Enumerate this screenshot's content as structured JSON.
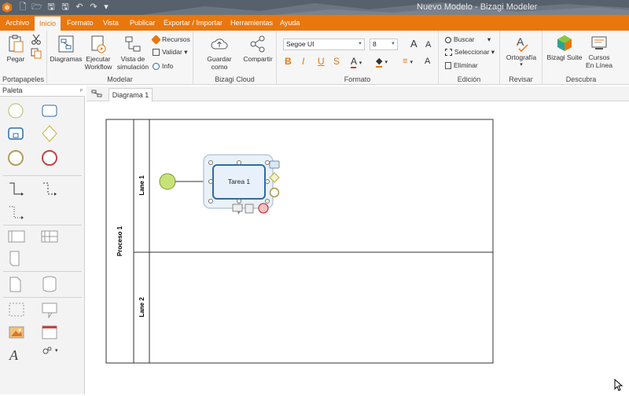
{
  "window": {
    "title": "Nuevo Modelo - Bizagi Modeler"
  },
  "ribbon_tabs": [
    {
      "label": "Archivo"
    },
    {
      "label": "Inicio",
      "active": true
    },
    {
      "label": "Formato"
    },
    {
      "label": "Vista"
    },
    {
      "label": "Publicar"
    },
    {
      "label": "Exportar / Importar"
    },
    {
      "label": "Herramientas"
    },
    {
      "label": "Ayuda"
    }
  ],
  "groups": {
    "portapapeles": {
      "label": "Portapapeles",
      "pegar": "Pegar"
    },
    "modelar": {
      "label": "Modelar",
      "diagramas": "Diagramas",
      "ejecutar": [
        "Ejecutar",
        "Workflow"
      ],
      "vista": [
        "Vista de",
        "simulación"
      ],
      "recursos": "Recursos",
      "validar": "Validar",
      "info": "Info"
    },
    "cloud": {
      "label": "Bizagi Cloud",
      "guardar": "Guardar como",
      "compartir": "Compartir"
    },
    "formato": {
      "label": "Formato",
      "font": "Segoe UI",
      "size": "8"
    },
    "edicion": {
      "label": "Edición",
      "buscar": "Buscar",
      "seleccionar": "Seleccionar",
      "eliminar": "Eliminar"
    },
    "revisar": {
      "label": "Revisar",
      "ortografia": "Ortografía"
    },
    "descubra": {
      "label": "Descubra",
      "suite": "Bizagi Suite",
      "cursos": [
        "Cursos",
        "En Línea"
      ]
    }
  },
  "palette": {
    "title": "Paleta",
    "pin": "ᵖ"
  },
  "document_tab": {
    "label": "Diagrama 1"
  },
  "diagram": {
    "pool": "Proceso 1",
    "lanes": [
      "Lane 1",
      "Lane 2"
    ],
    "task": "Tarea 1"
  },
  "colors": {
    "accent": "#e9770e",
    "task_stroke": "#2e6ca4",
    "start_event": "#c8e27a"
  }
}
